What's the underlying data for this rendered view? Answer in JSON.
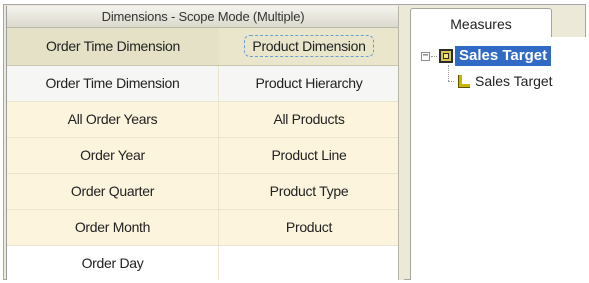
{
  "grid": {
    "title": "Dimensions - Scope Mode (Multiple)",
    "headers": [
      "Order Time Dimension",
      "Product Dimension"
    ],
    "rows": [
      [
        "Order Time Dimension",
        "Product Hierarchy"
      ],
      [
        "All Order Years",
        "All Products"
      ],
      [
        "Order Year",
        "Product Line"
      ],
      [
        "Order Quarter",
        "Product Type"
      ],
      [
        "Order Month",
        "Product"
      ],
      [
        "Order Day",
        ""
      ]
    ]
  },
  "measures_tab": {
    "label": "Measures"
  },
  "tree": {
    "expander": "−",
    "root": {
      "label": "Sales Target",
      "icon": "cube-icon",
      "children": [
        {
          "label": "Sales Target",
          "icon": "measure-icon"
        }
      ]
    }
  },
  "colors": {
    "selection": "#316ac5",
    "header_bg": "#e9e6cc",
    "tint_row": "#fcf4dc"
  }
}
